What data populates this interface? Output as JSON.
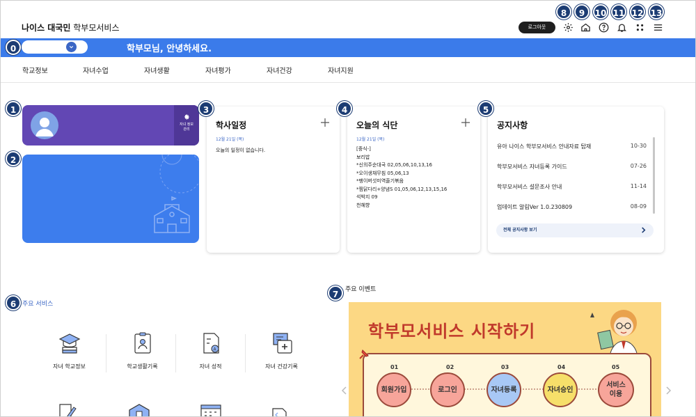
{
  "header": {
    "logo_brand": "나이스 대국민",
    "logo_service": "학부모서비스",
    "logout_label": "로그아웃",
    "icons": [
      "gear-icon",
      "home-icon",
      "help-icon",
      "bell-icon",
      "apps-icon",
      "menu-icon"
    ]
  },
  "badges": [
    "0",
    "1",
    "2",
    "3",
    "4",
    "5",
    "6",
    "7",
    "8",
    "9",
    "10",
    "11",
    "12",
    "13"
  ],
  "greeting": "학부모님, 안녕하세요.",
  "nav": [
    "학교정보",
    "자녀수업",
    "자녀생활",
    "자녀평가",
    "자녀건강",
    "자녀지원"
  ],
  "profile": {
    "manage_label_1": "자녀 정보",
    "manage_label_2": "관리"
  },
  "schedule": {
    "title": "학사일정",
    "date": "12월 21일 (목)",
    "empty_text": "오늘의 일정이 없습니다."
  },
  "meal": {
    "title": "오늘의 식단",
    "date": "12월 21일 (목)",
    "items": [
      "[중식-]",
      "보리밥",
      "*신의주순대국 02,05,06,10,13,16",
      "*오이생채무침 05,06,13",
      "*팽이버섯미역줄기볶음",
      "*찜닭다리+양념S 01,05,06,12,13,15,16",
      "석박지 09",
      "천혜향"
    ]
  },
  "notice": {
    "title": "공지사항",
    "items": [
      {
        "title": "유아 나이스 학부모서비스 안내자료 탑재",
        "date": "10-30"
      },
      {
        "title": "학부모서비스 자녀등록 가이드",
        "date": "07-26"
      },
      {
        "title": "학부모서비스 설문조사 안내",
        "date": "11-14"
      },
      {
        "title": "업데이트 알림Ver 1.0.230809",
        "date": "08-09"
      }
    ],
    "view_all": "전체 공지사항 보기"
  },
  "services": {
    "title": "주요 서비스",
    "items": [
      "자녀 학교정보",
      "학교생활기록",
      "자녀 성적",
      "자녀 건강기록"
    ]
  },
  "event": {
    "section_title": "주요 이벤트",
    "banner_title": "학부모서비스 시작하기",
    "steps": [
      {
        "num": "01",
        "label": "회원가입"
      },
      {
        "num": "02",
        "label": "로그인"
      },
      {
        "num": "03",
        "label": "자녀등록"
      },
      {
        "num": "04",
        "label": "자녀승인"
      },
      {
        "num": "05",
        "label": "서비스 이용"
      }
    ]
  },
  "colors": {
    "primary_blue": "#3b7bea",
    "profile_purple": "#6247b4",
    "badge_navy": "#1c3c73",
    "event_yellow": "#fcd884"
  }
}
